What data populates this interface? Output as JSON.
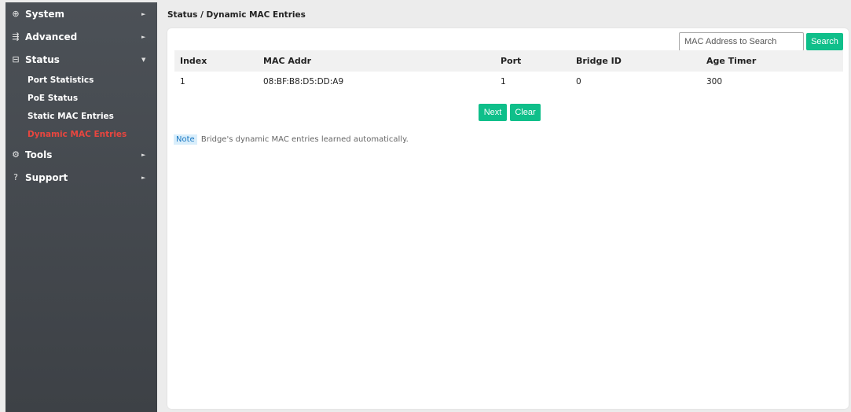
{
  "sidebar": {
    "items": [
      {
        "icon": "globe-icon",
        "glyph": "⊕",
        "label": "System",
        "arrow": "►"
      },
      {
        "icon": "sliders-icon",
        "glyph": "⇶",
        "label": "Advanced",
        "arrow": "►"
      },
      {
        "icon": "monitor-icon",
        "glyph": "⊟",
        "label": "Status",
        "arrow": "▼"
      },
      {
        "icon": "gear-icon",
        "glyph": "⚙",
        "label": "Tools",
        "arrow": "►"
      },
      {
        "icon": "question-circle-icon",
        "glyph": "?",
        "label": "Support",
        "arrow": "►"
      }
    ],
    "status_subitems": [
      {
        "label": "Port Statistics"
      },
      {
        "label": "PoE Status"
      },
      {
        "label": "Static MAC Entries"
      },
      {
        "label": "Dynamic MAC Entries",
        "active": true
      }
    ],
    "active_color": "#e8463f"
  },
  "breadcrumb": "Status / Dynamic MAC Entries",
  "search": {
    "placeholder": "MAC Address to Search",
    "value": "",
    "button": "Search"
  },
  "table": {
    "headers": [
      "Index",
      "MAC Addr",
      "Port",
      "Bridge ID",
      "Age Timer"
    ],
    "rows": [
      [
        "1",
        "08:BF:B8:D5:DD:A9",
        "1",
        "0",
        "300"
      ]
    ]
  },
  "buttons": {
    "next": "Next",
    "clear": "Clear"
  },
  "note": {
    "badge": "Note",
    "text": "Bridge's dynamic MAC entries learned automatically."
  },
  "colors": {
    "accent": "#0fbf8a",
    "sidebar": "#44494e"
  }
}
